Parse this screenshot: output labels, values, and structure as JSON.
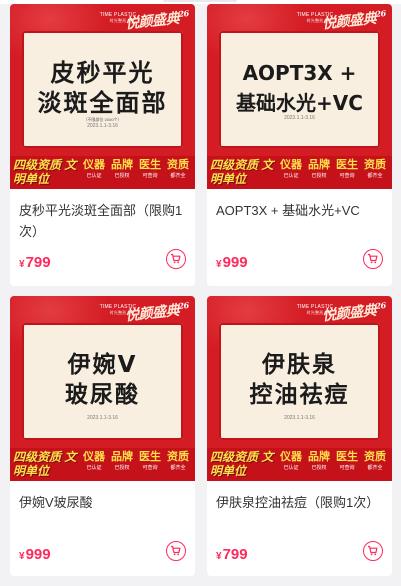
{
  "colors": {
    "accent": "#ff2a5e",
    "banner_red": "#d41c24",
    "panel_cream": "#f8efe0",
    "footer_yellow": "#ffe04a"
  },
  "banner": {
    "brand_line1": "TIME PLASTIC",
    "brand_line2": "时光整形",
    "festival": "悦颜盛典",
    "festival_num": "26",
    "footer_big": "四级资质 文明单位",
    "badges": [
      {
        "head": "仪器",
        "sub": "已认证"
      },
      {
        "head": "品牌",
        "sub": "已授权"
      },
      {
        "head": "医生",
        "sub": "可查询"
      },
      {
        "head": "资质",
        "sub": "都齐全"
      }
    ]
  },
  "products": [
    {
      "image_line1": "皮秒平光",
      "image_line2": "淡斑全面部",
      "image_note": "（不限部位·2000个）",
      "image_date": "2023.1.1-3.16",
      "title": "皮秒平光淡斑全面部（限购1次）",
      "currency": "¥",
      "price": "799",
      "cart_icon": "cart-icon"
    },
    {
      "image_line1": "AOPT3X +",
      "image_line2": "基础水光+VC",
      "image_note": "",
      "image_date": "2023.1.1-3.16",
      "title": "AOPT3X + 基础水光+VC",
      "currency": "¥",
      "price": "999",
      "cart_icon": "cart-icon"
    },
    {
      "image_line1": "伊婉V",
      "image_line2": "玻尿酸",
      "image_note": "",
      "image_date": "2023.1.1-3.16",
      "title": "伊婉V玻尿酸",
      "currency": "¥",
      "price": "999",
      "cart_icon": "cart-icon"
    },
    {
      "image_line1": "伊肤泉",
      "image_line2": "控油祛痘",
      "image_note": "",
      "image_date": "2023.1.1-3.16",
      "title": "伊肤泉控油祛痘（限购1次）",
      "currency": "¥",
      "price": "799",
      "cart_icon": "cart-icon"
    }
  ]
}
